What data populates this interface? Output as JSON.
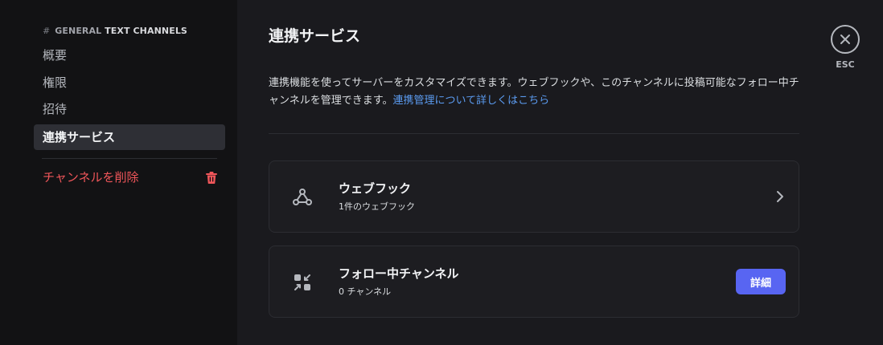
{
  "sidebar": {
    "header_hash": "#",
    "header_channel": "GENERAL",
    "header_category": "TEXT CHANNELS",
    "items": [
      {
        "label": "概要"
      },
      {
        "label": "権限"
      },
      {
        "label": "招待"
      },
      {
        "label": "連携サービス",
        "active": true
      }
    ],
    "delete_label": "チャンネルを削除"
  },
  "main": {
    "title": "連携サービス",
    "description": "連携機能を使ってサーバーをカスタマイズできます。ウェブフックや、このチャンネルに投稿可能なフォロー中チャンネルを管理できます。",
    "learn_more_link": "連携管理について詳しくはこちら",
    "cards": [
      {
        "title": "ウェブフック",
        "subtitle": "1件のウェブフック",
        "icon": "webhook-icon"
      },
      {
        "title": "フォロー中チャンネル",
        "subtitle": "0 チャンネル",
        "icon": "follow-channel-icon",
        "button_label": "詳細"
      }
    ]
  },
  "close": {
    "esc_label": "ESC"
  },
  "colors": {
    "accent": "#5865f2",
    "danger": "#f0565a",
    "link": "#5b9bf0",
    "background": "#1a1a1e",
    "sidebar_background": "#121214"
  }
}
